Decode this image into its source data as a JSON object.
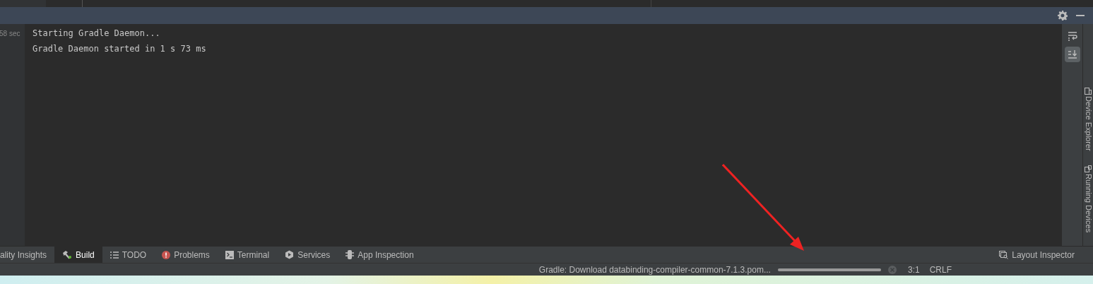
{
  "gutter": {
    "time": "58 sec"
  },
  "console": {
    "lines": [
      "Starting Gradle Daemon...",
      "Gradle Daemon started in 1 s 73 ms"
    ]
  },
  "console_toolbar": [
    {
      "kind": "wrap",
      "selected": false
    },
    {
      "kind": "scroll",
      "selected": true
    }
  ],
  "side_tabs": [
    {
      "kind": "device",
      "label": "Device Explorer"
    },
    {
      "kind": "running",
      "label": "Running Devices"
    }
  ],
  "tool_tabs": [
    {
      "kind": "none",
      "label": "ality Insights",
      "selected": false
    },
    {
      "kind": "build",
      "label": "Build",
      "selected": true
    },
    {
      "kind": "todo",
      "label": "TODO",
      "selected": false
    },
    {
      "kind": "problems",
      "label": "Problems",
      "selected": false
    },
    {
      "kind": "terminal",
      "label": "Terminal",
      "selected": false
    },
    {
      "kind": "services",
      "label": "Services",
      "selected": false
    },
    {
      "kind": "inspection",
      "label": "App Inspection",
      "selected": false
    }
  ],
  "right_tool_tab": {
    "label": "Layout Inspector"
  },
  "status_bar": {
    "task": "Gradle: Download databinding-compiler-common-7.1.3.pom...",
    "progress": {
      "level": 1
    },
    "position": "3:1",
    "line_separator": "CRLF"
  }
}
